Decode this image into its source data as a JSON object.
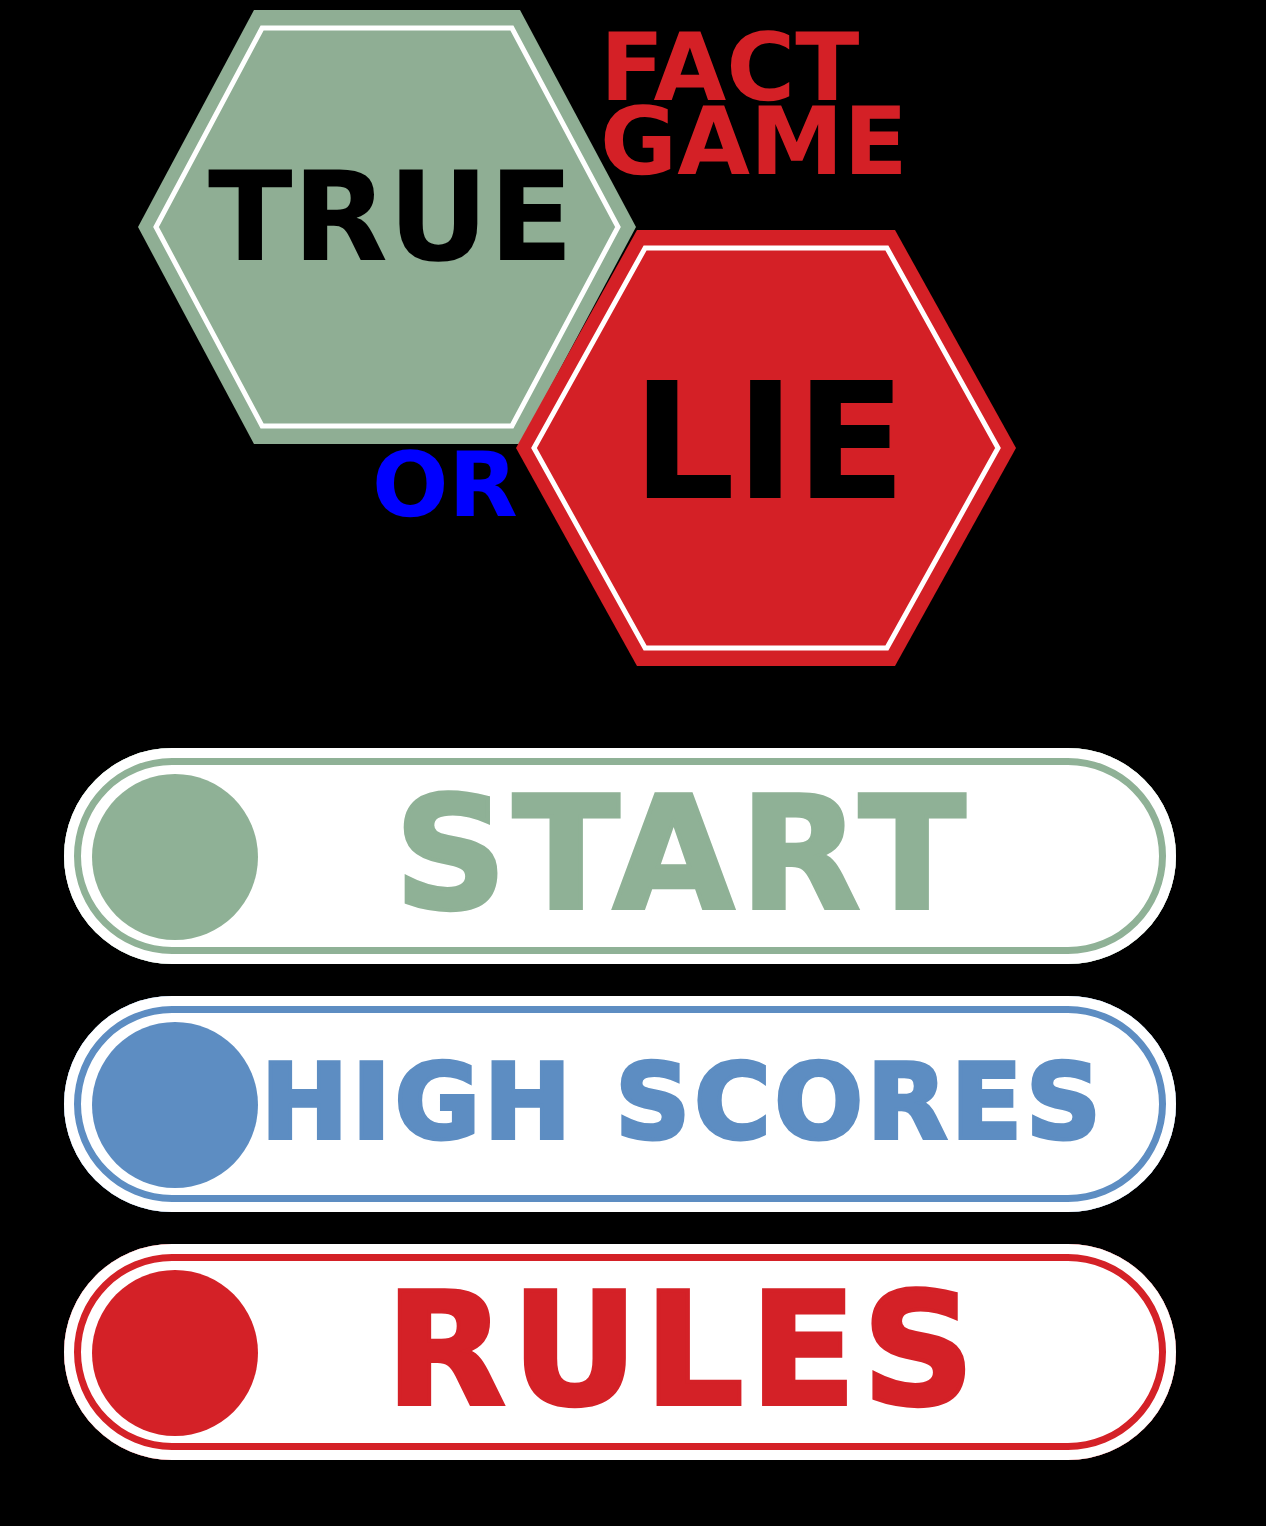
{
  "logo": {
    "tagline": "FACT GAME",
    "hexagons": [
      {
        "word": "TRUE",
        "color": "#8fae94"
      },
      {
        "word": "LIE",
        "color": "#d42026"
      }
    ],
    "connector": "OR"
  },
  "menu": [
    {
      "label": "START",
      "color": "#8fb196"
    },
    {
      "label": "HIGH SCORES",
      "color": "#5d8dc2"
    },
    {
      "label": "RULES",
      "color": "#d42127"
    }
  ]
}
